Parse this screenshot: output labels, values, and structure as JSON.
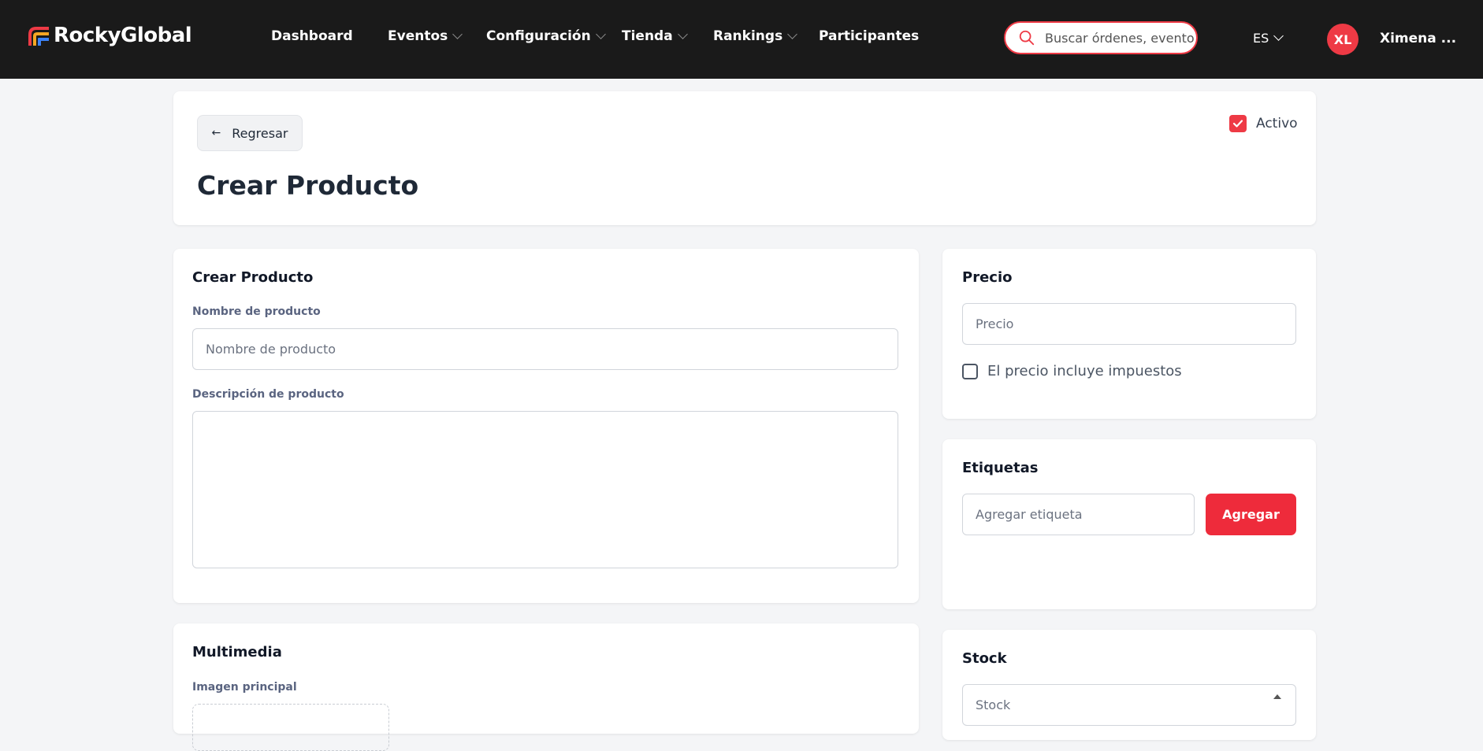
{
  "brand": {
    "name": "RockyGlobal"
  },
  "nav": {
    "dashboard": "Dashboard",
    "eventos": "Eventos",
    "configuracion": "Configuración",
    "tienda": "Tienda",
    "rankings": "Rankings",
    "participantes": "Participantes"
  },
  "search": {
    "placeholder": "Buscar órdenes, eventos"
  },
  "language": "ES",
  "user": {
    "initials": "XL",
    "name": "Ximena ..."
  },
  "header": {
    "back_label": "Regresar",
    "title": "Crear Producto",
    "active_label": "Activo",
    "active_checked": true
  },
  "product_card": {
    "title": "Crear Producto",
    "name_label": "Nombre de producto",
    "name_placeholder": "Nombre de producto",
    "name_value": "",
    "description_label": "Descripción de producto",
    "description_value": ""
  },
  "media_card": {
    "title": "Multimedia",
    "main_image_label": "Imagen principal"
  },
  "price_card": {
    "title": "Precio",
    "price_placeholder": "Precio",
    "price_value": "",
    "tax_label": "El precio incluye impuestos",
    "tax_checked": false
  },
  "tags_card": {
    "title": "Etiquetas",
    "tag_placeholder": "Agregar etiqueta",
    "add_label": "Agregar"
  },
  "stock_card": {
    "title": "Stock",
    "stock_placeholder": "Stock"
  },
  "colors": {
    "accent": "#ee2b3b",
    "navbar": "#1a1a1a",
    "background": "#f4f5f7"
  }
}
